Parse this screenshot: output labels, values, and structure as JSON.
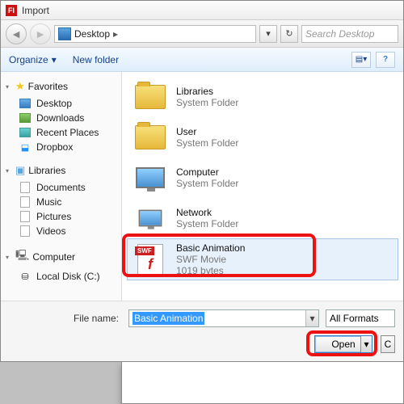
{
  "title": "Import",
  "breadcrumb": {
    "location": "Desktop"
  },
  "search": {
    "placeholder": "Search Desktop"
  },
  "toolbar": {
    "organize": "Organize",
    "newfolder": "New folder"
  },
  "sidebar": {
    "favorites": {
      "label": "Favorites",
      "items": [
        "Desktop",
        "Downloads",
        "Recent Places",
        "Dropbox"
      ]
    },
    "libraries": {
      "label": "Libraries",
      "items": [
        "Documents",
        "Music",
        "Pictures",
        "Videos"
      ]
    },
    "computer": {
      "label": "Computer",
      "items": [
        "Local Disk (C:)"
      ]
    }
  },
  "files": [
    {
      "name": "Libraries",
      "sub1": "System Folder",
      "sub2": ""
    },
    {
      "name": "User",
      "sub1": "System Folder",
      "sub2": ""
    },
    {
      "name": "Computer",
      "sub1": "System Folder",
      "sub2": ""
    },
    {
      "name": "Network",
      "sub1": "System Folder",
      "sub2": ""
    },
    {
      "name": "Basic Animation",
      "sub1": "SWF Movie",
      "sub2": "1019 bytes"
    }
  ],
  "footer": {
    "filename_label": "File name:",
    "filename_value": "Basic Animation",
    "filter": "All Formats",
    "open": "Open",
    "cancel": "C"
  }
}
